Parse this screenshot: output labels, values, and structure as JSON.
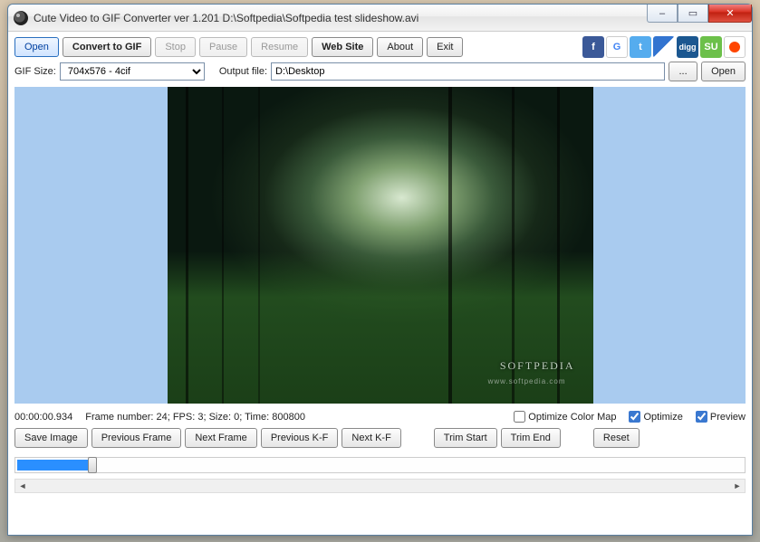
{
  "window": {
    "title": "Cute Video to GIF Converter ver 1.201  D:\\Softpedia\\Softpedia test slideshow.avi"
  },
  "toolbar": {
    "open": "Open",
    "convert": "Convert to GIF",
    "stop": "Stop",
    "pause": "Pause",
    "resume": "Resume",
    "website": "Web Site",
    "about": "About",
    "exit": "Exit"
  },
  "social": {
    "facebook": "f",
    "google": "g",
    "twitter": "t",
    "delicious": "d",
    "digg": "digg",
    "stumble": "SU",
    "reddit": "r"
  },
  "row2": {
    "gif_size_label": "GIF Size:",
    "gif_size_value": "704x576 - 4cif",
    "output_label": "Output file:",
    "output_value": "D:\\Desktop",
    "browse": "...",
    "open": "Open"
  },
  "preview": {
    "watermark": "SOFTPEDIA",
    "watermark_sub": "www.softpedia.com"
  },
  "status": {
    "timecode": "00:00:00.934",
    "info": "Frame number: 24; FPS: 3; Size: 0; Time: 800800",
    "optimize_colormap": "Optimize Color Map",
    "optimize": "Optimize",
    "preview": "Preview"
  },
  "controls": {
    "save_image": "Save Image",
    "prev_frame": "Previous Frame",
    "next_frame": "Next Frame",
    "prev_kf": "Previous K-F",
    "next_kf": "Next K-F",
    "trim_start": "Trim Start",
    "trim_end": "Trim End",
    "reset": "Reset"
  }
}
